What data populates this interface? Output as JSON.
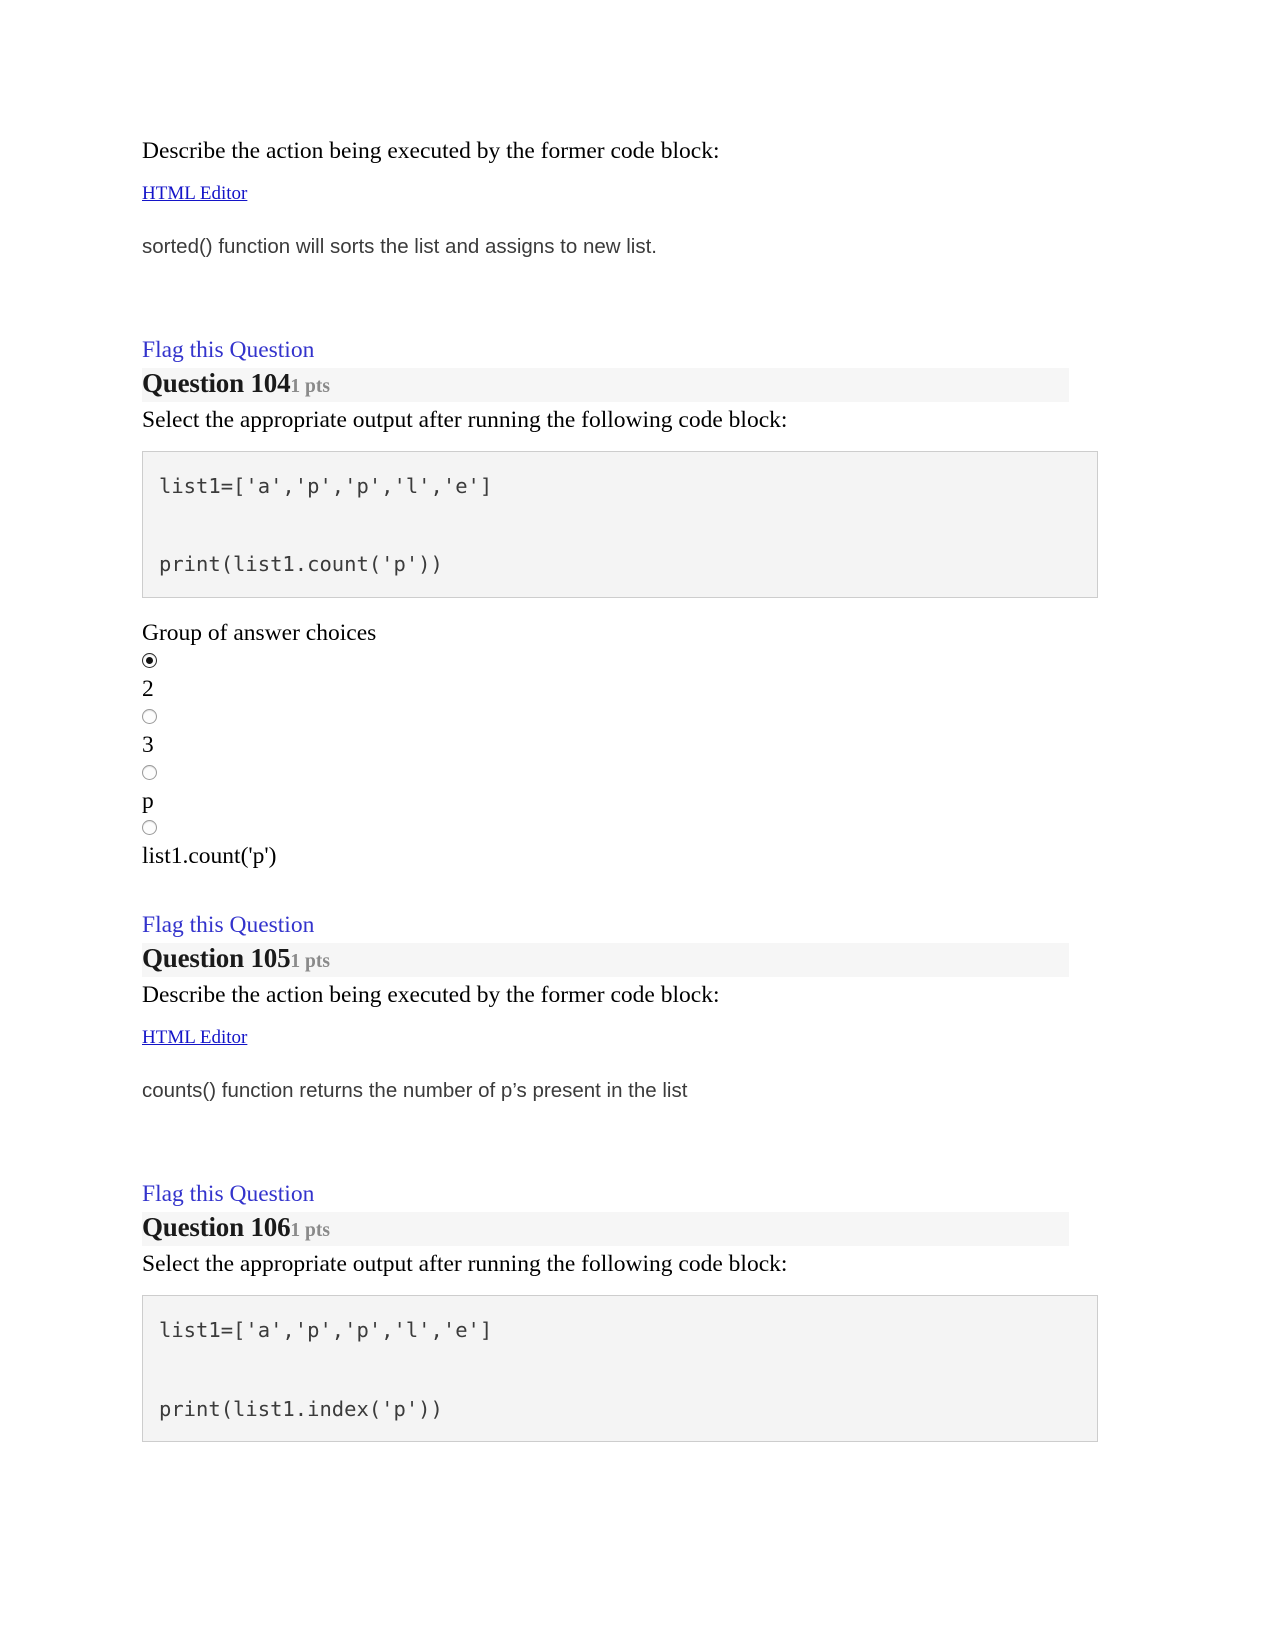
{
  "document": {
    "intro": {
      "prompt": "Describe the action being executed by the former code block:",
      "editor_link": "HTML Editor",
      "answer_text": "sorted() function will sorts the list and assigns to new list."
    },
    "questions": [
      {
        "flag_label": "Flag this Question",
        "title": "Question 104",
        "points": "1 pts",
        "prompt": "Select the appropriate output after running the following code block:",
        "code_lines": [
          "list1=['a','p','p','l','e']",
          "print(list1.count('p'))"
        ],
        "choices_label": "Group of answer choices",
        "choices": [
          {
            "value": "2",
            "selected": true
          },
          {
            "value": "3",
            "selected": false
          },
          {
            "value": "p",
            "selected": false
          },
          {
            "value": "list1.count('p')",
            "selected": false
          }
        ]
      },
      {
        "flag_label": "Flag this Question",
        "title": "Question 105",
        "points": "1 pts",
        "prompt": "Describe the action being executed by the former code block:",
        "editor_link": "HTML Editor",
        "answer_text": "counts() function returns the number of p’s present in the list"
      },
      {
        "flag_label": "Flag this Question",
        "title": "Question 106",
        "points": "1 pts",
        "prompt": "Select the appropriate output after running the following code block:",
        "code_lines": [
          "list1=['a','p','p','l','e']",
          "print(list1.index('p'))"
        ]
      }
    ]
  },
  "colors": {
    "link_blue": "#3333cc",
    "editor_link_blue": "#1414c8",
    "header_band": "#f6f6f6",
    "code_bg": "#f4f4f4",
    "code_border": "#cdcdcd",
    "points_gray": "#8a8a8a"
  }
}
